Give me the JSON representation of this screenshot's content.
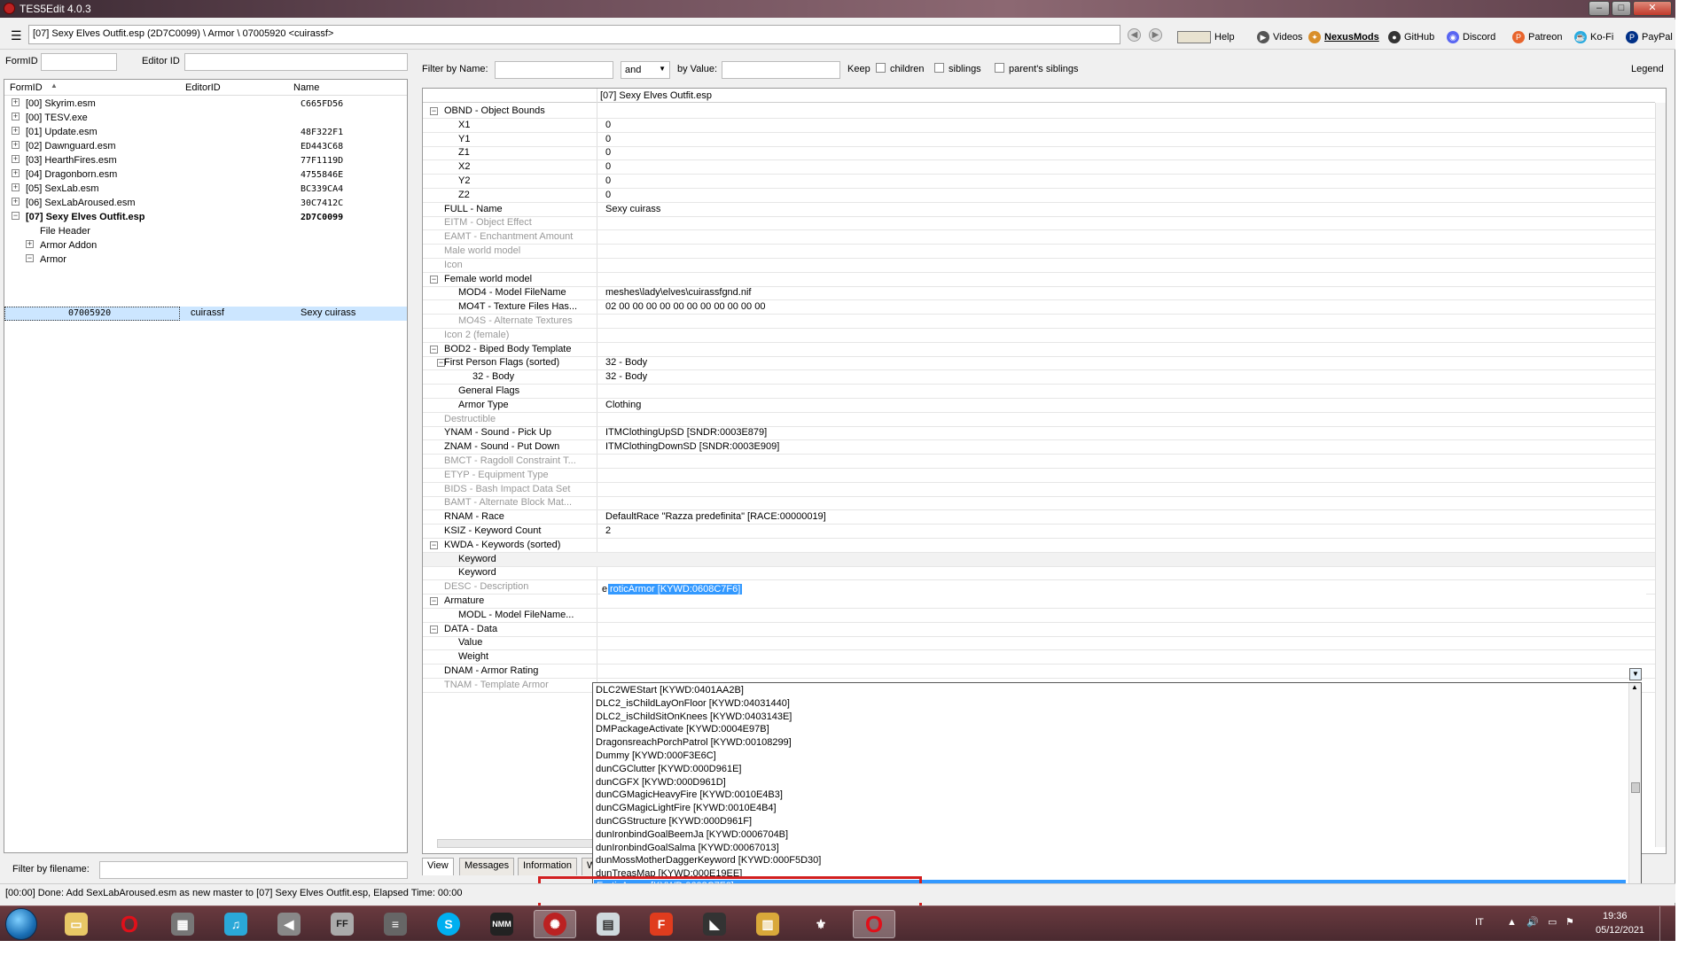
{
  "window": {
    "title": "TES5Edit 4.0.3",
    "min": "–",
    "max": "□",
    "close": "✕"
  },
  "path": "[07] Sexy Elves Outfit.esp (2D7C0099) \\ Armor \\ 07005920 <cuirassf>",
  "toolbar": {
    "help": "Help",
    "videos": "Videos",
    "nexus": "NexusMods",
    "github": "GitHub",
    "discord": "Discord",
    "patreon": "Patreon",
    "kofi": "Ko-Fi",
    "paypal": "PayPal"
  },
  "left": {
    "formid_label": "FormID",
    "editorid_label": "Editor ID",
    "headers": {
      "formid": "FormID",
      "editorid": "EditorID",
      "name": "Name"
    },
    "rows": [
      {
        "label": "[00] Skyrim.esm",
        "name": "C665FD56",
        "exp": "+"
      },
      {
        "label": "[00] TESV.exe",
        "name": "",
        "exp": "+"
      },
      {
        "label": "[01] Update.esm",
        "name": "48F322F1",
        "exp": "+"
      },
      {
        "label": "[02] Dawnguard.esm",
        "name": "ED443C68",
        "exp": "+"
      },
      {
        "label": "[03] HearthFires.esm",
        "name": "77F1119D",
        "exp": "+"
      },
      {
        "label": "[04] Dragonborn.esm",
        "name": "4755846E",
        "exp": "+"
      },
      {
        "label": "[05] SexLab.esm",
        "name": "BC339CA4",
        "exp": "+"
      },
      {
        "label": "[06] SexLabAroused.esm",
        "name": "30C7412C",
        "exp": "+"
      },
      {
        "label": "[07] Sexy Elves Outfit.esp",
        "name": "2D7C0099",
        "exp": "−"
      },
      {
        "label": "File Header",
        "name": "",
        "exp": ""
      },
      {
        "label": "Armor Addon",
        "name": "",
        "exp": "+"
      },
      {
        "label": "Armor",
        "name": "",
        "exp": "−"
      }
    ],
    "selected": {
      "formid": "07005920",
      "editorid": "cuirassf",
      "name": "Sexy cuirass"
    },
    "filter_filename": "Filter by filename:"
  },
  "right": {
    "filter_name": "Filter by Name:",
    "and": "and",
    "by_value": "by Value:",
    "keep": "Keep",
    "children": "children",
    "siblings": "siblings",
    "parents_siblings": "parent's siblings",
    "legend": "Legend",
    "column_header": "[07] Sexy Elves Outfit.esp",
    "records": [
      {
        "name": "OBND - Object Bounds",
        "value": "",
        "indent": 0,
        "exp": "−",
        "gray": false
      },
      {
        "name": "X1",
        "value": "0",
        "indent": 2,
        "exp": "",
        "gray": false
      },
      {
        "name": "Y1",
        "value": "0",
        "indent": 2,
        "exp": "",
        "gray": false
      },
      {
        "name": "Z1",
        "value": "0",
        "indent": 2,
        "exp": "",
        "gray": false
      },
      {
        "name": "X2",
        "value": "0",
        "indent": 2,
        "exp": "",
        "gray": false
      },
      {
        "name": "Y2",
        "value": "0",
        "indent": 2,
        "exp": "",
        "gray": false
      },
      {
        "name": "Z2",
        "value": "0",
        "indent": 2,
        "exp": "",
        "gray": false
      },
      {
        "name": "FULL - Name",
        "value": "Sexy cuirass",
        "indent": 1,
        "exp": "",
        "gray": false
      },
      {
        "name": "EITM - Object Effect",
        "value": "",
        "indent": 1,
        "exp": "",
        "gray": true
      },
      {
        "name": "EAMT - Enchantment Amount",
        "value": "",
        "indent": 1,
        "exp": "",
        "gray": true
      },
      {
        "name": "Male world model",
        "value": "",
        "indent": 1,
        "exp": "",
        "gray": true
      },
      {
        "name": "Icon",
        "value": "",
        "indent": 1,
        "exp": "",
        "gray": true
      },
      {
        "name": "Female world model",
        "value": "",
        "indent": 0,
        "exp": "−",
        "gray": false
      },
      {
        "name": "MOD4 - Model FileName",
        "value": "meshes\\lady\\elves\\cuirassfgnd.nif",
        "indent": 2,
        "exp": "",
        "gray": false
      },
      {
        "name": "MO4T - Texture Files Has...",
        "value": "02 00 00 00 00 00 00 00 00 00 00 00",
        "indent": 2,
        "exp": "",
        "gray": false
      },
      {
        "name": "MO4S - Alternate Textures",
        "value": "",
        "indent": 2,
        "exp": "",
        "gray": true
      },
      {
        "name": "Icon 2 (female)",
        "value": "",
        "indent": 1,
        "exp": "",
        "gray": true
      },
      {
        "name": "BOD2 - Biped Body Template",
        "value": "",
        "indent": 0,
        "exp": "−",
        "gray": false
      },
      {
        "name": "First Person Flags (sorted)",
        "value": "32 - Body",
        "indent": 1,
        "exp": "−",
        "gray": false
      },
      {
        "name": "32 - Body",
        "value": "32 - Body",
        "indent": 3,
        "exp": "",
        "gray": false
      },
      {
        "name": "General Flags",
        "value": "",
        "indent": 2,
        "exp": "",
        "gray": false
      },
      {
        "name": "Armor Type",
        "value": "Clothing",
        "indent": 2,
        "exp": "",
        "gray": false
      },
      {
        "name": "Destructible",
        "value": "",
        "indent": 1,
        "exp": "",
        "gray": true
      },
      {
        "name": "YNAM - Sound - Pick Up",
        "value": "ITMClothingUpSD [SNDR:0003E879]",
        "indent": 1,
        "exp": "",
        "gray": false
      },
      {
        "name": "ZNAM - Sound - Put Down",
        "value": "ITMClothingDownSD [SNDR:0003E909]",
        "indent": 1,
        "exp": "",
        "gray": false
      },
      {
        "name": "BMCT - Ragdoll Constraint T...",
        "value": "",
        "indent": 1,
        "exp": "",
        "gray": true
      },
      {
        "name": "ETYP - Equipment Type",
        "value": "",
        "indent": 1,
        "exp": "",
        "gray": true
      },
      {
        "name": "BIDS - Bash Impact Data Set",
        "value": "",
        "indent": 1,
        "exp": "",
        "gray": true
      },
      {
        "name": "BAMT - Alternate Block Mat...",
        "value": "",
        "indent": 1,
        "exp": "",
        "gray": true
      },
      {
        "name": "RNAM - Race",
        "value": "DefaultRace \"Razza predefinita\" [RACE:00000019]",
        "indent": 1,
        "exp": "",
        "gray": false
      },
      {
        "name": "KSIZ - Keyword Count",
        "value": "2",
        "indent": 1,
        "exp": "",
        "gray": false
      },
      {
        "name": "KWDA - Keywords (sorted)",
        "value": "",
        "indent": 0,
        "exp": "−",
        "gray": false
      },
      {
        "name": "Keyword",
        "value": "",
        "indent": 2,
        "exp": "",
        "gray": false
      },
      {
        "name": "Keyword",
        "value": "",
        "indent": 2,
        "exp": "",
        "gray": false
      },
      {
        "name": "DESC - Description",
        "value": "",
        "indent": 1,
        "exp": "",
        "gray": true
      },
      {
        "name": "Armature",
        "value": "",
        "indent": 0,
        "exp": "−",
        "gray": false
      },
      {
        "name": "MODL - Model FileName...",
        "value": "",
        "indent": 2,
        "exp": "",
        "gray": false
      },
      {
        "name": "DATA - Data",
        "value": "",
        "indent": 0,
        "exp": "−",
        "gray": false
      },
      {
        "name": "Value",
        "value": "",
        "indent": 2,
        "exp": "",
        "gray": false
      },
      {
        "name": "Weight",
        "value": "",
        "indent": 2,
        "exp": "",
        "gray": false
      },
      {
        "name": "DNAM - Armor Rating",
        "value": "",
        "indent": 1,
        "exp": "",
        "gray": false
      },
      {
        "name": "TNAM - Template Armor",
        "value": "",
        "indent": 1,
        "exp": "",
        "gray": true
      }
    ],
    "edit_value_prefix": "e",
    "edit_value_selected": "roticArmor [KYWD:0608C7F6]",
    "dropdown": [
      "DLC2WEStart [KYWD:0401AA2B]",
      "DLC2_isChildLayOnFloor [KYWD:04031440]",
      "DLC2_isChildSitOnKnees [KYWD:0403143E]",
      "DMPackageActivate [KYWD:0004E97B]",
      "DragonsreachPorchPatrol [KYWD:00108299]",
      "Dummy [KYWD:000F3E6C]",
      "dunCGClutter [KYWD:000D961E]",
      "dunCGFX [KYWD:000D961D]",
      "dunCGMagicHeavyFire [KYWD:0010E4B3]",
      "dunCGMagicLightFire [KYWD:0010E4B4]",
      "dunCGStructure [KYWD:000D961F]",
      "dunIronbindGoalBeemJa [KYWD:0006704B]",
      "dunIronbindGoalSalma [KYWD:00067013]",
      "dunMossMotherDaggerKeyword [KYWD:000F5D30]",
      "dunTreasMap [KYWD:000E19EE]"
    ],
    "dropdown_selected": "EroticArmor [KYWD:0608C7F6]",
    "tabs": [
      "View",
      "Messages",
      "Information",
      "W"
    ]
  },
  "status": "[00:00] Done: Add SexLabAroused.esm as new master to [07] Sexy Elves Outfit.esp, Elapsed Time: 00:00",
  "taskbar": {
    "lang": "IT",
    "time": "19:36",
    "date": "05/12/2021"
  }
}
